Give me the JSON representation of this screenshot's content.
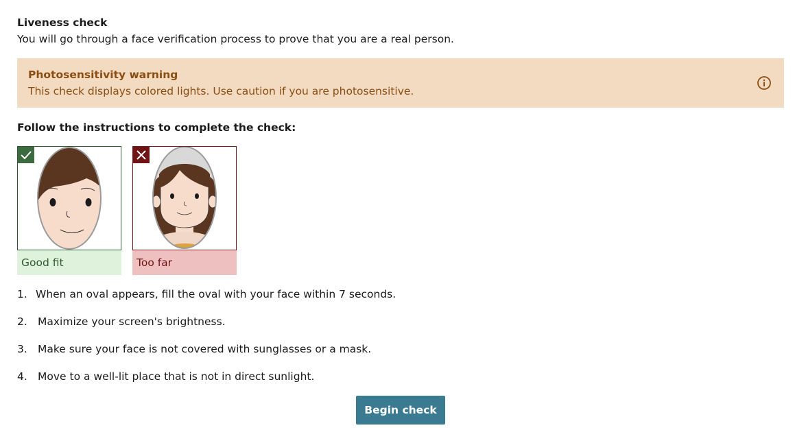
{
  "header": {
    "title": "Liveness check",
    "subtitle": "You will go through a face verification process to prove that you are a real person."
  },
  "warning": {
    "title": "Photosensitivity warning",
    "text": "This check displays colored lights. Use caution if you are photosensitive.",
    "icon": "info-icon",
    "color": "#8a4d12",
    "background": "#f3dbc1"
  },
  "instructions_heading": "Follow the instructions to complete the check:",
  "examples": [
    {
      "label": "Good fit",
      "status_icon": "checkmark-icon",
      "accent": "#3b6b3f"
    },
    {
      "label": "Too far",
      "status_icon": "x-icon",
      "accent": "#6e1414"
    }
  ],
  "steps": [
    {
      "num": "1.",
      "text": "When an oval appears, fill the oval with your face within 7 seconds."
    },
    {
      "num": "2.",
      "text": "Maximize your screen's brightness."
    },
    {
      "num": "3.",
      "text": "Make sure your face is not covered with sunglasses or a mask."
    },
    {
      "num": "4.",
      "text": "Move to a well-lit place that is not in direct sunlight."
    }
  ],
  "actions": {
    "begin_label": "Begin check",
    "button_color": "#3a7b91"
  }
}
